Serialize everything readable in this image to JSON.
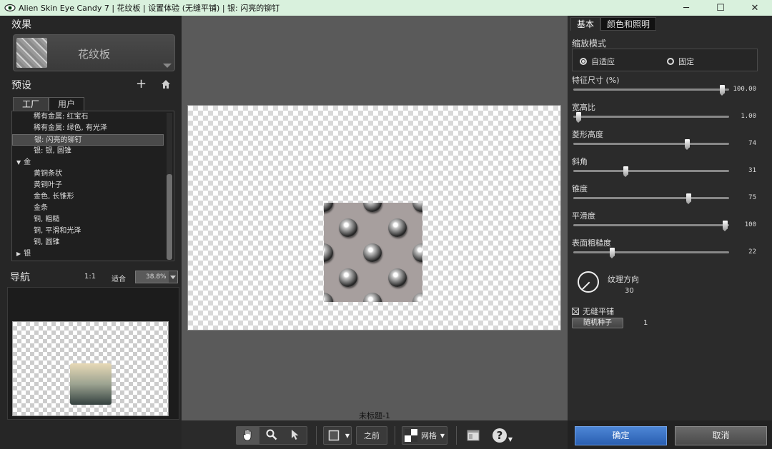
{
  "window": {
    "title": "Alien Skin Eye Candy 7 | 花纹板 | 设置体验 (无缝平铺) | 银: 闪亮的铆钉",
    "minimize": "─",
    "maximize": "☐",
    "close": "✕"
  },
  "left": {
    "effect_title": "效果",
    "effect_name": "花纹板",
    "preset_title": "预设",
    "preset_add": "+",
    "tabs": [
      {
        "label": "工厂",
        "active": true
      },
      {
        "label": "用户",
        "active": false
      }
    ],
    "preset_items": [
      {
        "label": "稀有金属: 红宝石",
        "type": "item"
      },
      {
        "label": "稀有金属: 绿色, 有光泽",
        "type": "item"
      },
      {
        "label": "银: 闪亮的铆钉",
        "type": "item",
        "selected": true
      },
      {
        "label": "银: 银, 圆锥",
        "type": "item"
      },
      {
        "label": "金",
        "type": "group",
        "expanded": true
      },
      {
        "label": "黄铜条状",
        "type": "item"
      },
      {
        "label": "黄铜叶子",
        "type": "item"
      },
      {
        "label": "金色, 长锥形",
        "type": "item"
      },
      {
        "label": "金条",
        "type": "item"
      },
      {
        "label": "铜, 粗糙",
        "type": "item"
      },
      {
        "label": "铜, 平滑和光泽",
        "type": "item"
      },
      {
        "label": "铜, 圆锥",
        "type": "item"
      },
      {
        "label": "银",
        "type": "group",
        "expanded": false
      }
    ],
    "nav_title": "导航",
    "nav_one_to_one": "1:1",
    "nav_fit": "适合",
    "nav_zoom": "38.8%"
  },
  "center": {
    "doc_title": "未标题-1"
  },
  "toolbar": {
    "before_label": "之前",
    "grid_label": "网格",
    "help_label": "?"
  },
  "right": {
    "tabs": [
      {
        "label": "基本",
        "active": true
      },
      {
        "label": "颜色和照明",
        "active": false
      }
    ],
    "scale_mode_label": "缩放模式",
    "scale_mode_options": [
      {
        "label": "自适应",
        "checked": true
      },
      {
        "label": "固定",
        "checked": false
      }
    ],
    "sliders": [
      {
        "label": "特征尺寸 (%)",
        "value": "100.00",
        "fraction": 0.97
      },
      {
        "label": "宽高比",
        "value": "1.00",
        "fraction": 0.02
      },
      {
        "label": "菱形高度",
        "value": "74",
        "fraction": 0.74
      },
      {
        "label": "斜角",
        "value": "31",
        "fraction": 0.33
      },
      {
        "label": "锥度",
        "value": "75",
        "fraction": 0.75
      },
      {
        "label": "平滑度",
        "value": "100",
        "fraction": 0.99
      },
      {
        "label": "表面粗糙度",
        "value": "22",
        "fraction": 0.24
      }
    ],
    "texture_dir_label": "纹理方向",
    "texture_dir_value": "30",
    "seamless_label": "无缝平铺",
    "seamless_checked": true,
    "random_seed_label": "随机种子",
    "random_seed_value": "1",
    "ok_label": "确定",
    "cancel_label": "取消"
  }
}
